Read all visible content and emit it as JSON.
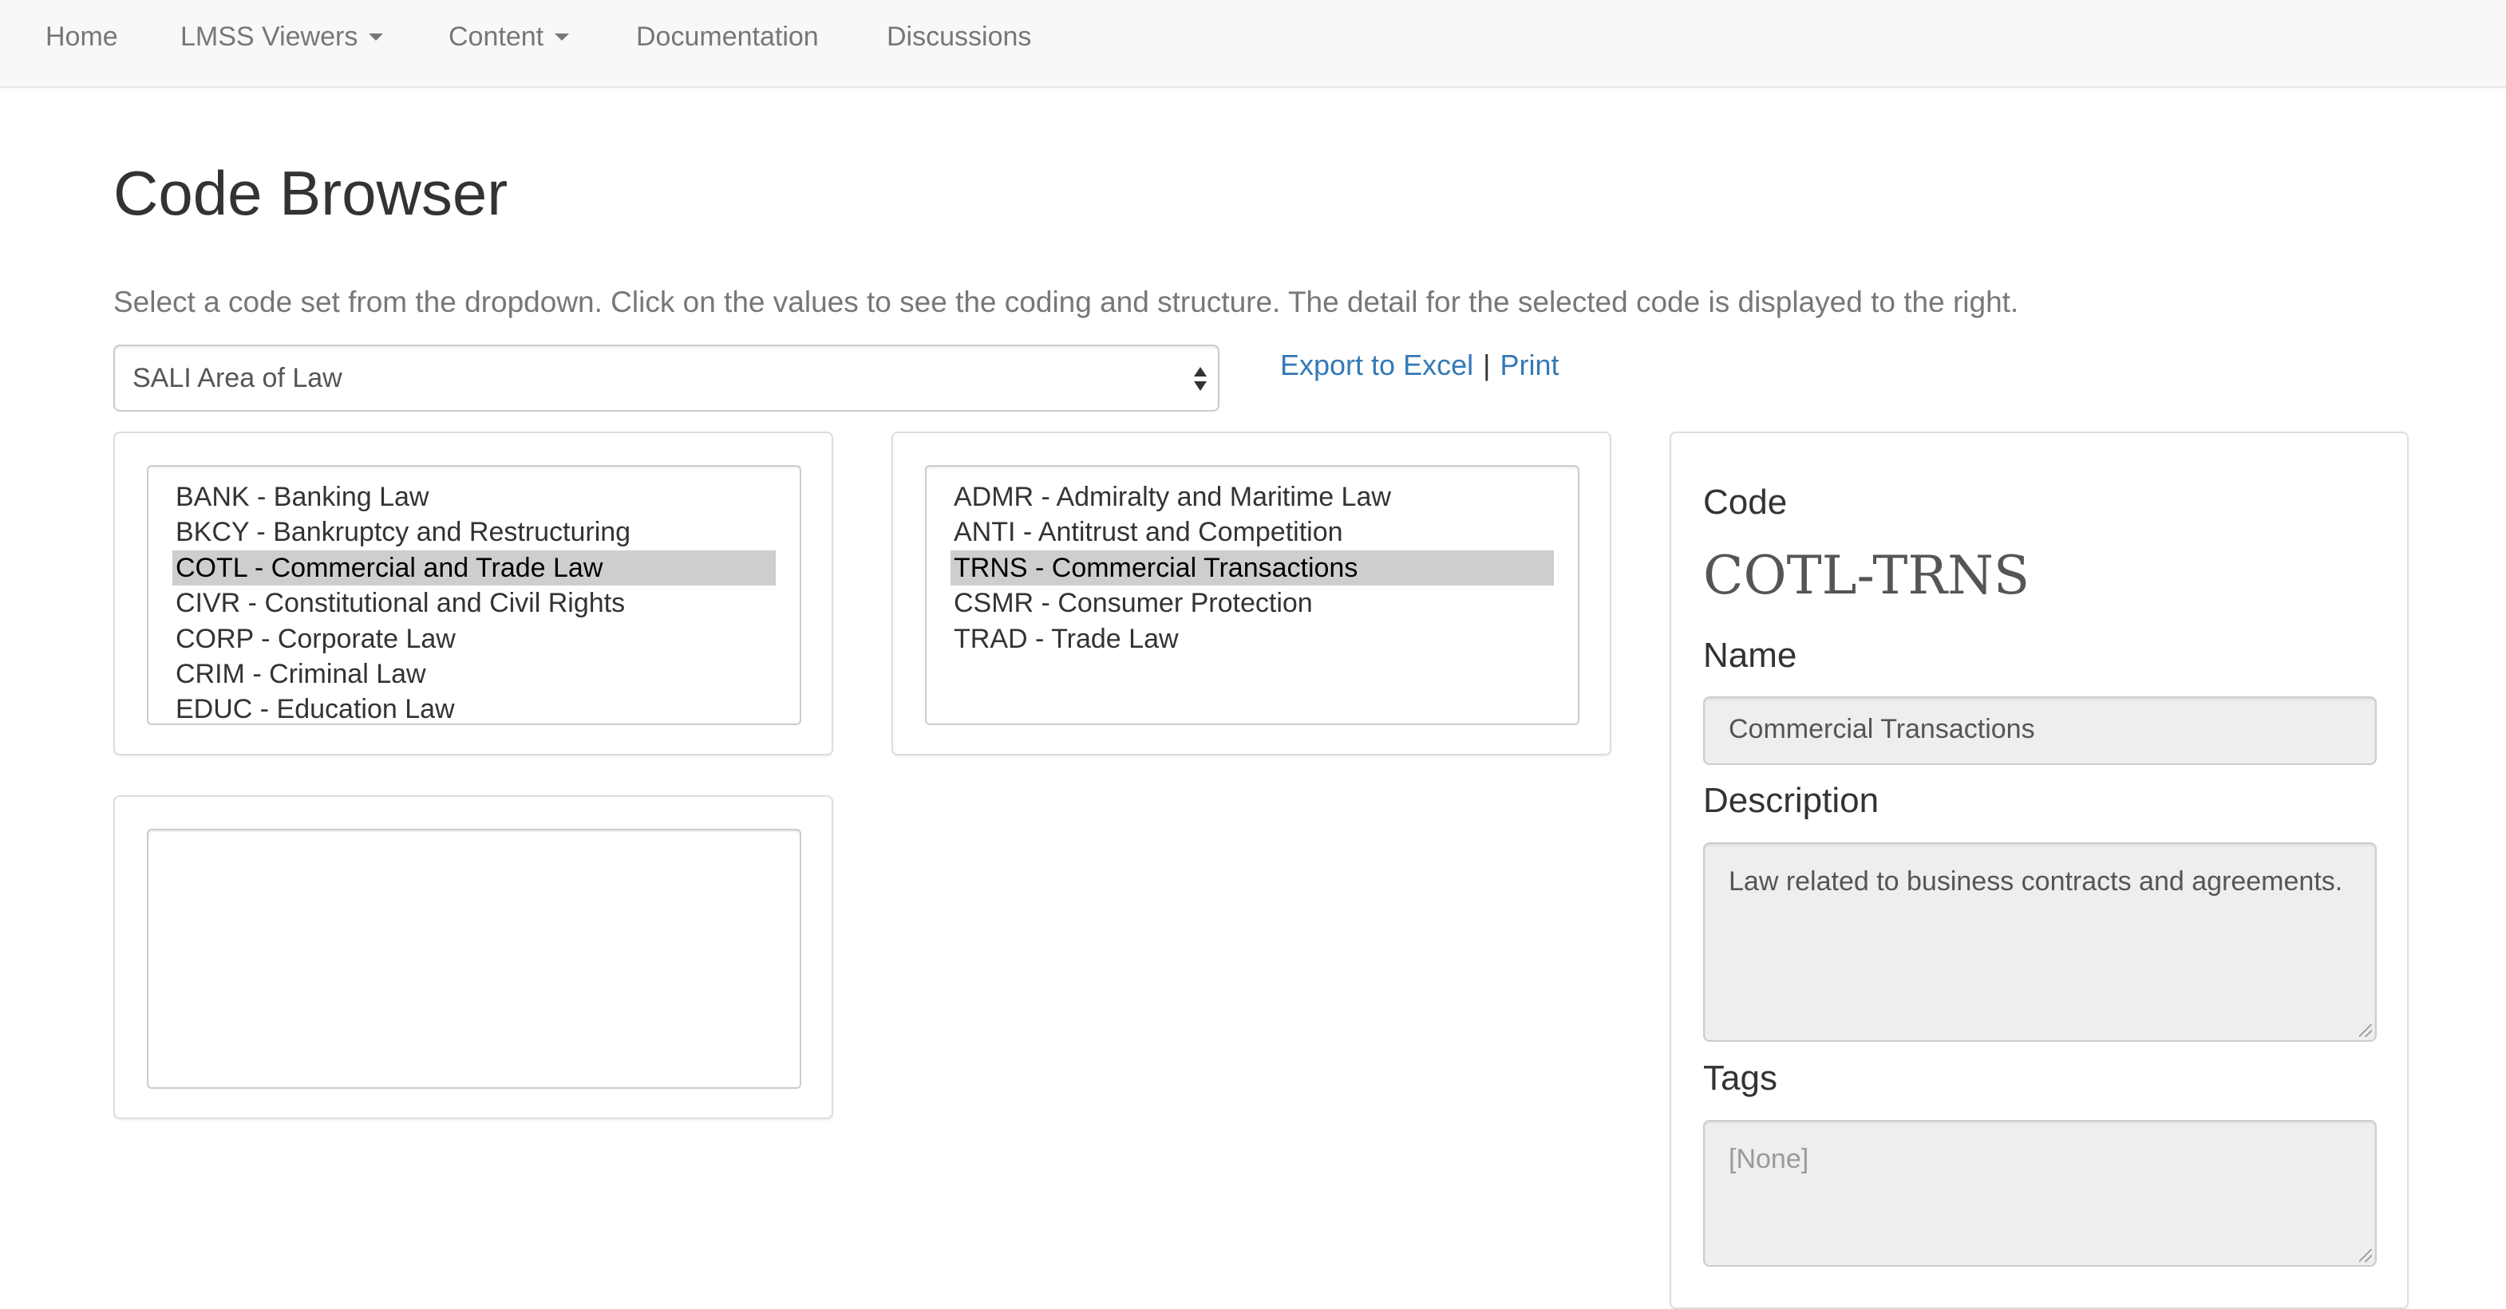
{
  "nav": {
    "home": "Home",
    "lmss_viewers": "LMSS Viewers",
    "content": "Content",
    "documentation": "Documentation",
    "discussions": "Discussions"
  },
  "page": {
    "title": "Code Browser",
    "intro": "Select a code set from the dropdown. Click on the values to see the coding and structure. The detail for the selected code is displayed to the right."
  },
  "codeset": {
    "selected": "SALI Area of Law"
  },
  "links": {
    "export": "Export to Excel",
    "separator": "|",
    "print": "Print"
  },
  "level1": {
    "items": [
      "BANK - Banking Law",
      "BKCY - Bankruptcy and Restructuring",
      "COTL - Commercial and Trade Law",
      "CIVR - Constitutional and Civil Rights",
      "CORP - Corporate Law",
      "CRIM - Criminal Law",
      "EDUC - Education Law"
    ],
    "selected_index": 2
  },
  "level2": {
    "items": [
      "ADMR - Admiralty and Maritime Law",
      "ANTI - Antitrust and Competition",
      "TRNS - Commercial Transactions",
      "CSMR - Consumer Protection",
      "TRAD - Trade Law"
    ],
    "selected_index": 2
  },
  "level3": {
    "items": []
  },
  "detail": {
    "code_label": "Code",
    "code_value": "COTL-TRNS",
    "name_label": "Name",
    "name_value": "Commercial Transactions",
    "description_label": "Description",
    "description_value": "Law related to business contracts and agreements.",
    "tags_label": "Tags",
    "tags_value": "[None]"
  },
  "colors": {
    "link": "#337ab7",
    "selected_row": "#cecece",
    "navbar_bg": "#f8f8f8",
    "readonly_bg": "#eeeeee"
  }
}
